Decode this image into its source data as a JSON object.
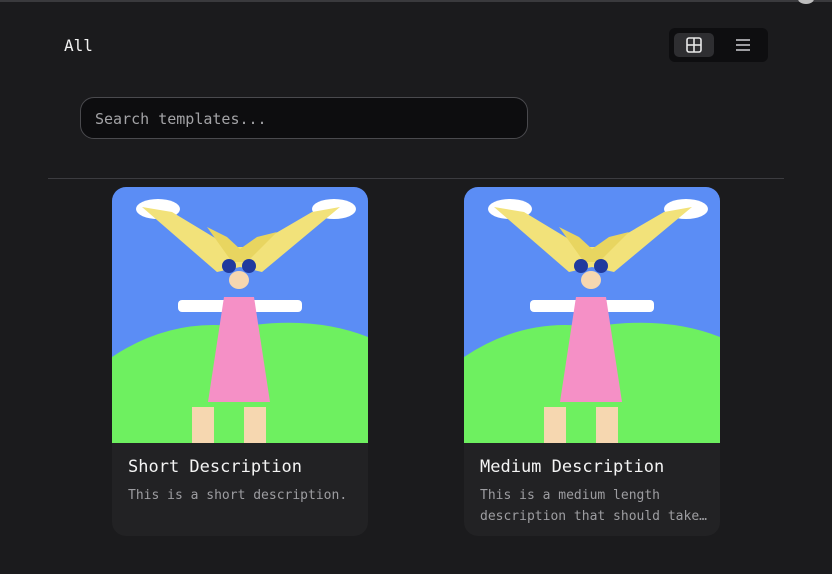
{
  "filter": {
    "label": "All"
  },
  "view_toggle": {
    "active": "grid",
    "options": [
      "grid-icon",
      "list-icon"
    ]
  },
  "search": {
    "placeholder": "Search templates...",
    "value": ""
  },
  "templates": [
    {
      "title": "Short Description",
      "description": "This is a short description.",
      "thumbnail": "cartoon-girl-image"
    },
    {
      "title": "Medium Description",
      "description": "This is a medium length description that should take up two lines",
      "thumbnail": "cartoon-girl-image"
    }
  ],
  "colors": {
    "background": "#1b1b1d",
    "card": "#222224",
    "sky": "#5b8df5",
    "grass": "#6ef060",
    "dress": "#f590c6",
    "hair": "#f2e27a"
  }
}
